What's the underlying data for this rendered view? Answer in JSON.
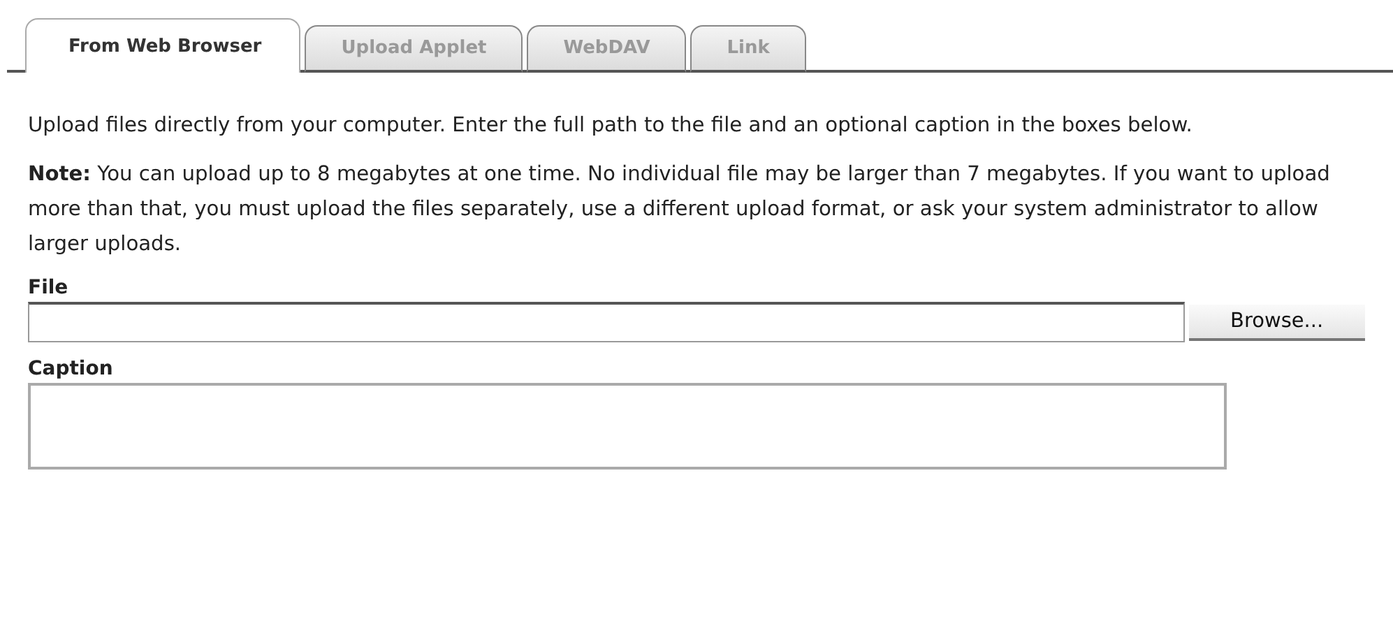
{
  "tabs": [
    {
      "label": "From Web Browser",
      "selected": true
    },
    {
      "label": "Upload Applet",
      "selected": false
    },
    {
      "label": "WebDAV",
      "selected": false
    },
    {
      "label": "Link",
      "selected": false
    }
  ],
  "intro": "Upload files directly from your computer. Enter the full path to the file and an optional caption in the boxes below.",
  "note": "**Note:** You can upload up to 8 megabytes at one time. No individual file may be larger than 7 megabytes. If you want to upload more than that, you must upload the files separately, use a different upload format, or ask your system administrator to allow larger uploads.",
  "file_field": {
    "label": "File",
    "button": "Browse..."
  },
  "caption_field": {
    "label": "Caption"
  }
}
